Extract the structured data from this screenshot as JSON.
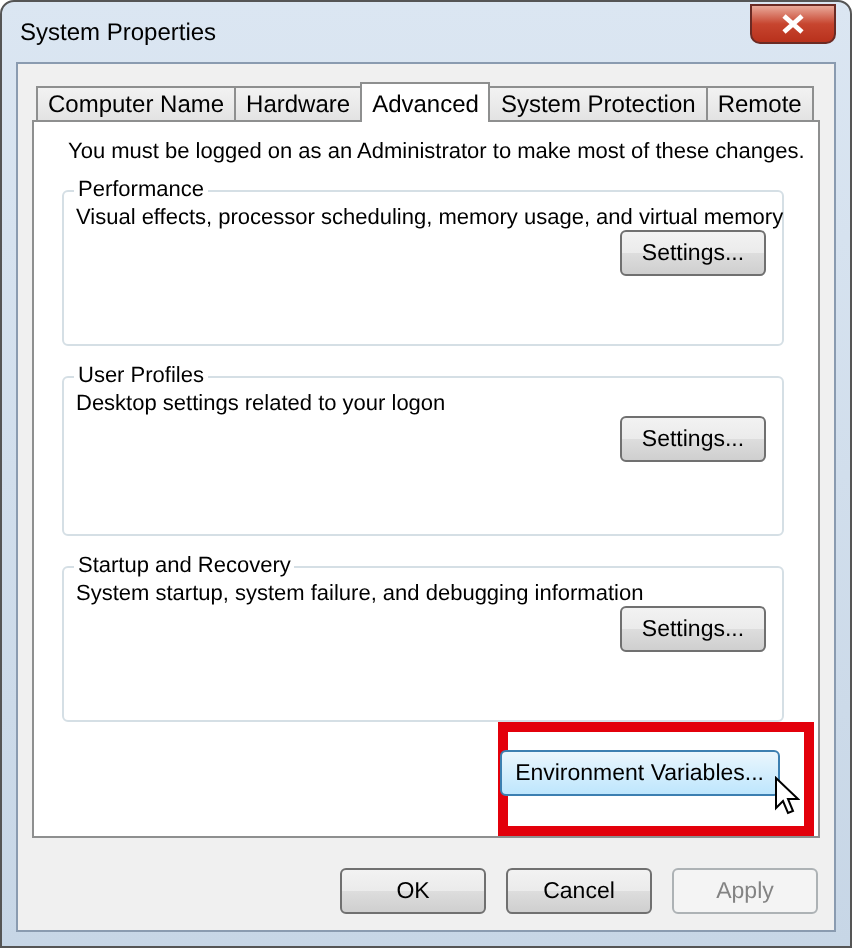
{
  "window": {
    "title": "System Properties"
  },
  "tabs": [
    {
      "label": "Computer Name",
      "selected": false
    },
    {
      "label": "Hardware",
      "selected": false
    },
    {
      "label": "Advanced",
      "selected": true
    },
    {
      "label": "System Protection",
      "selected": false
    },
    {
      "label": "Remote",
      "selected": false
    }
  ],
  "notice": "You must be logged on as an Administrator to make most of these changes.",
  "groups": [
    {
      "title": "Performance",
      "description": "Visual effects, processor scheduling, memory usage, and virtual memory",
      "button": "Settings..."
    },
    {
      "title": "User Profiles",
      "description": "Desktop settings related to your logon",
      "button": "Settings..."
    },
    {
      "title": "Startup and Recovery",
      "description": "System startup, system failure, and debugging information",
      "button": "Settings..."
    }
  ],
  "environment_button": {
    "label": "Environment Variables...",
    "highlighted": true,
    "hovered": true
  },
  "buttons": [
    {
      "label": "OK",
      "disabled": false
    },
    {
      "label": "Cancel",
      "disabled": false
    },
    {
      "label": "Apply",
      "disabled": true
    }
  ]
}
